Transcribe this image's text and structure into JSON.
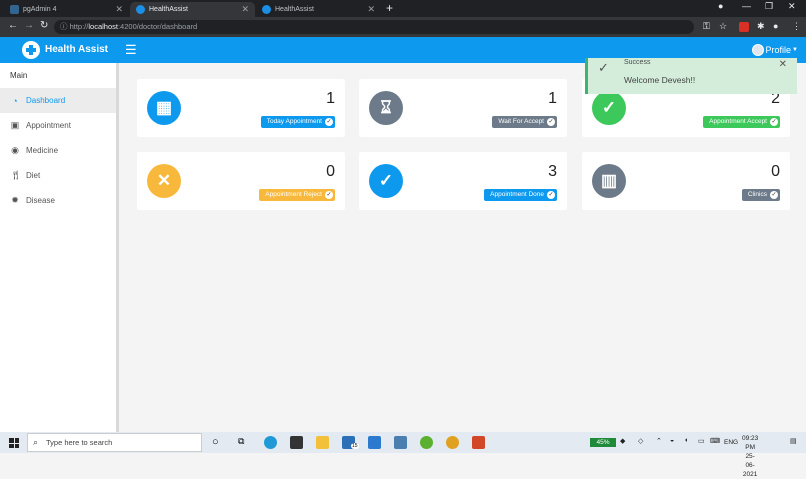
{
  "browser": {
    "tabs": [
      {
        "label": "pgAdmin 4",
        "favicon_color": "#326690"
      },
      {
        "label": "HealthAssist",
        "favicon_color": "#1a8fe3"
      },
      {
        "label": "HealthAssist",
        "favicon_color": "#1a8fe3"
      }
    ],
    "url_prefix": "http://",
    "url_host": "localhost",
    "url_rest": ":4200/doctor/dashboard"
  },
  "app": {
    "brand": "Health Assist",
    "profile_label": "Profile",
    "accent": "#0d99ee"
  },
  "sidebar": {
    "section": "Main",
    "items": [
      {
        "label": "Dashboard",
        "icon": "dashboard-icon",
        "active": true
      },
      {
        "label": "Appointment",
        "icon": "calendar-icon",
        "active": false
      },
      {
        "label": "Medicine",
        "icon": "pills-icon",
        "active": false
      },
      {
        "label": "Diet",
        "icon": "utensils-icon",
        "active": false
      },
      {
        "label": "Disease",
        "icon": "virus-icon",
        "active": false
      }
    ]
  },
  "cards": [
    {
      "count": "1",
      "label": "Today Appointment",
      "color": "#0d99ee",
      "icon": "calendar-check-icon"
    },
    {
      "count": "1",
      "label": "Wait For Accept",
      "color": "#6c7a89",
      "icon": "hourglass-icon"
    },
    {
      "count": "2",
      "label": "Appointment Accept",
      "color": "#3cc85a",
      "icon": "check-circle-icon"
    },
    {
      "count": "0",
      "label": "Appointment Reject",
      "color": "#f8b83c",
      "icon": "x-circle-icon"
    },
    {
      "count": "3",
      "label": "Appointment Done",
      "color": "#0d99ee",
      "icon": "check-done-icon"
    },
    {
      "count": "0",
      "label": "Clinics",
      "color": "#6c7a89",
      "icon": "building-icon"
    }
  ],
  "toast": {
    "title": "Success",
    "message": "Welcome Devesh!!"
  },
  "taskbar": {
    "search_placeholder": "Type here to search",
    "battery": "45%",
    "language": "ENG",
    "time": "09:23 PM",
    "date": "25-06-2021",
    "mail_badge": "15"
  }
}
